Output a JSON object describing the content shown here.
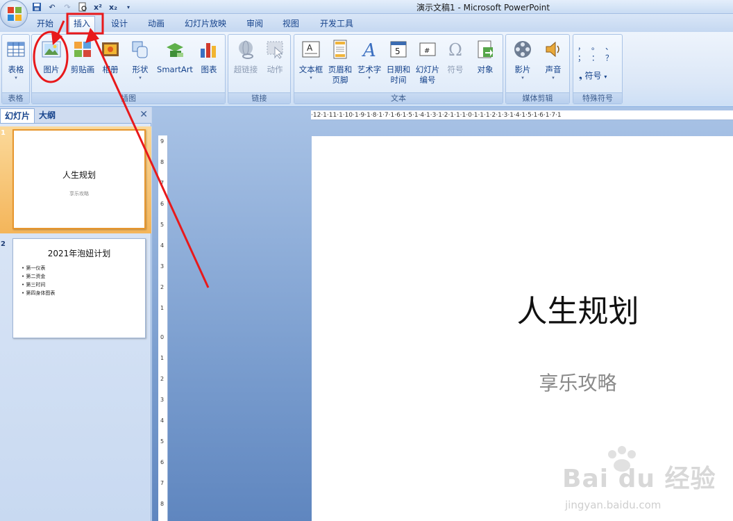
{
  "window": {
    "title": "演示文稿1 - Microsoft PowerPoint"
  },
  "tabs": [
    "开始",
    "插入",
    "设计",
    "动画",
    "幻灯片放映",
    "审阅",
    "视图",
    "开发工具"
  ],
  "active_tab": "插入",
  "ribbon": {
    "groups": {
      "table": "表格",
      "illustrations": "插图",
      "links": "链接",
      "text": "文本",
      "media": "媒体剪辑",
      "special": "特殊符号"
    },
    "buttons": {
      "table": "表格",
      "picture": "图片",
      "clipart": "剪贴画",
      "album": "相册",
      "shapes": "形状",
      "smartart": "SmartArt",
      "chart": "图表",
      "hyperlink": "超链接",
      "action": "动作",
      "textbox": "文本框",
      "header_footer_1": "页眉和",
      "header_footer_2": "页脚",
      "wordart": "艺术字",
      "datetime_1": "日期和",
      "datetime_2": "时间",
      "slidenum_1": "幻灯片",
      "slidenum_2": "编号",
      "symbol": "符号",
      "object": "对象",
      "movie": "影片",
      "sound": "声音",
      "special_symbol": "符号"
    },
    "special_chars": [
      "，",
      "。",
      "、",
      "；",
      "：",
      "？"
    ]
  },
  "panel": {
    "tabs": [
      "幻灯片",
      "大纲"
    ],
    "slides": [
      {
        "num": "1",
        "title": "人生规划",
        "subtitle": "享乐攻略"
      },
      {
        "num": "2",
        "title": "2021年泡妞计划",
        "bullets": [
          "第一仪表",
          "第二资金",
          "第三时间",
          "第四身体图表"
        ]
      }
    ]
  },
  "ruler": {
    "h": "·12·1·11·1·10·1·9·1·8·1·7·1·6·1·5·1·4·1·3·1·2·1·1·1·0·1·1·1·2·1·3·1·4·1·5·1·6·1·7·1",
    "v": [
      "9",
      "8",
      "7",
      "6",
      "5",
      "4",
      "3",
      "2",
      "1",
      "0",
      "1",
      "2",
      "3",
      "4",
      "5",
      "6",
      "7",
      "8"
    ]
  },
  "slide": {
    "title": "人生规划",
    "subtitle": "享乐攻略"
  },
  "watermark": {
    "brand": "Bai du 经验",
    "url": "jingyan.baidu.com"
  },
  "colors": {
    "annotation": "#e8191b"
  }
}
